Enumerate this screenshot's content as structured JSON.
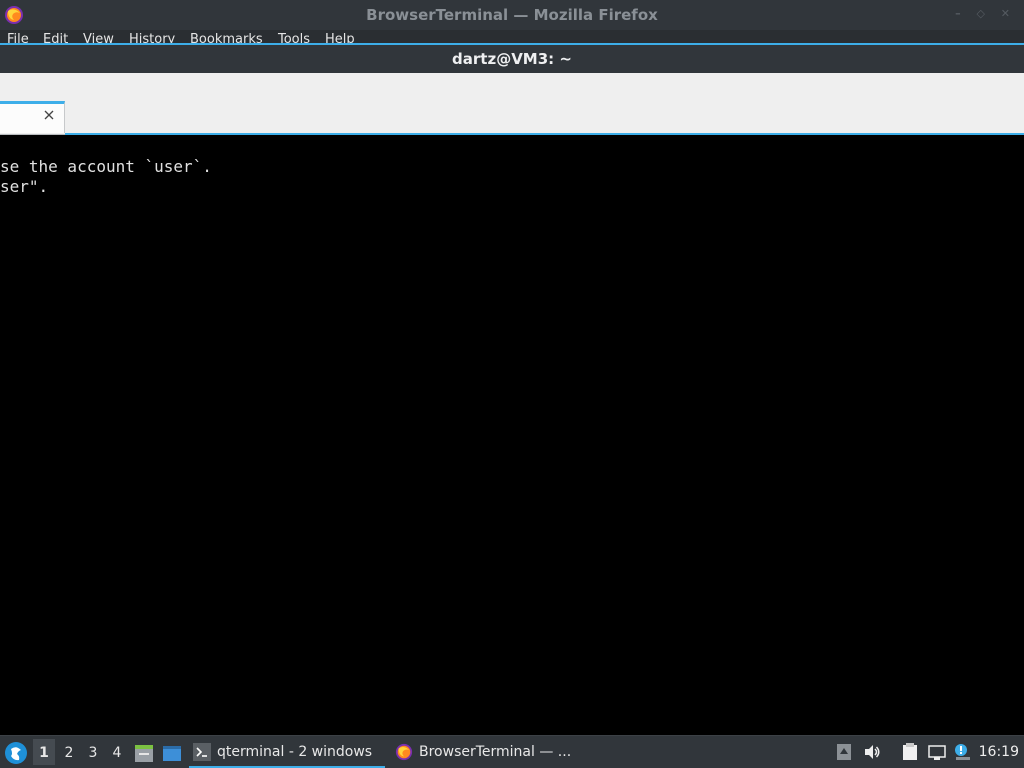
{
  "firefox": {
    "window_title": "BrowserTerminal — Mozilla Firefox",
    "menu": [
      "File",
      "Edit",
      "View",
      "History",
      "Bookmarks",
      "Tools",
      "Help"
    ]
  },
  "terminal": {
    "window_title": "dartz@VM3: ~",
    "tab_close": "×",
    "lines": [
      "se the account `user`.",
      "ser\"."
    ]
  },
  "taskbar": {
    "desktops": [
      "1",
      "2",
      "3",
      "4"
    ],
    "active_desktop": "1",
    "tasks": [
      {
        "label": "qterminal - 2 windows",
        "icon": "terminal-icon"
      },
      {
        "label": "BrowserTerminal — ...",
        "icon": "firefox-icon"
      }
    ],
    "clock": "16:19"
  },
  "colors": {
    "accent": "#3daee9",
    "titlebar": "#31363b",
    "terminal_bg": "#000000",
    "terminal_fg": "#e0e0e0"
  }
}
